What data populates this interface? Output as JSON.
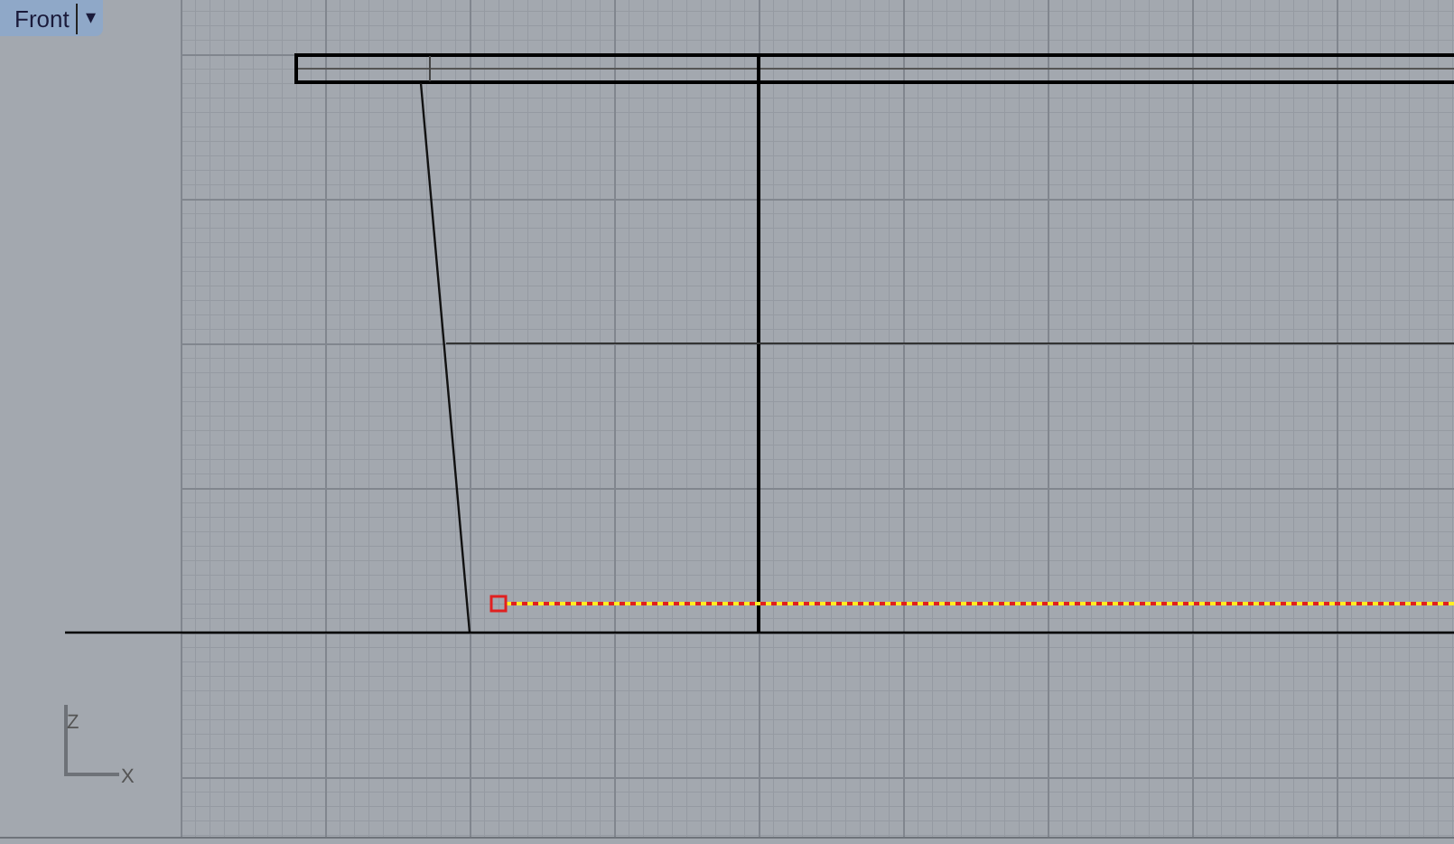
{
  "viewport": {
    "title": "Front",
    "active": true,
    "menu_icon": "▾"
  },
  "axes": [
    {
      "label": "Z",
      "kind": "vertical"
    },
    {
      "label": "X",
      "kind": "horizontal"
    }
  ],
  "curves": [
    {
      "kind": "selected",
      "selected": true
    }
  ]
}
